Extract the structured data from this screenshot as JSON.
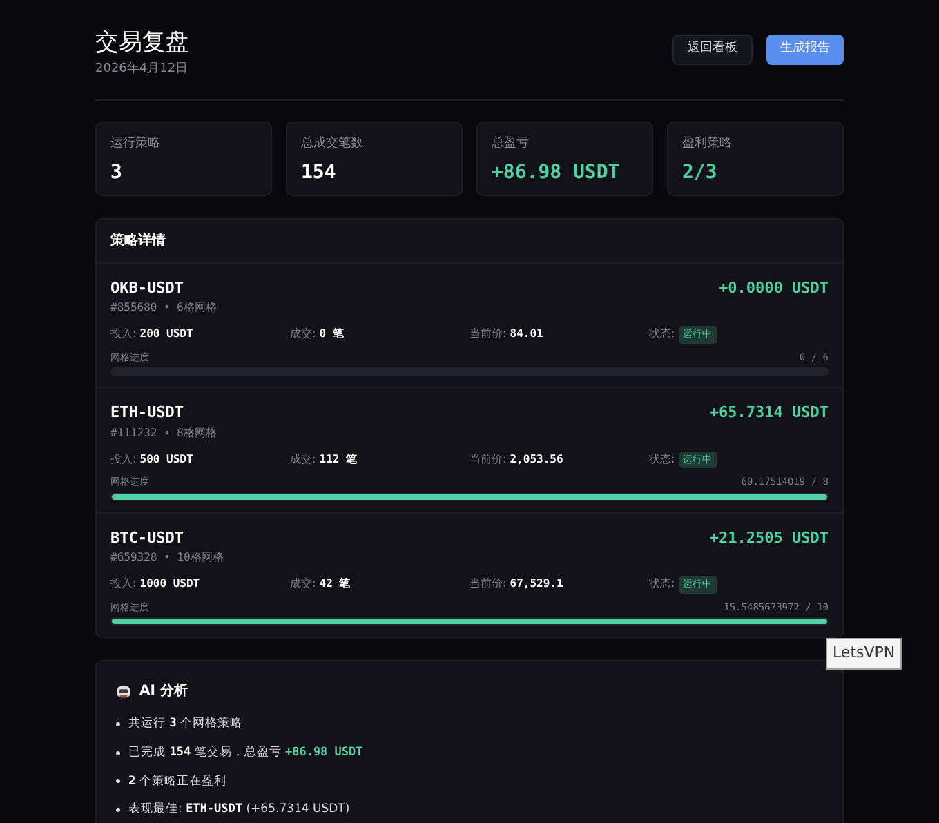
{
  "header": {
    "title": "交易复盘",
    "date": "2026年4月12日",
    "buttons": [
      {
        "label": "返回看板",
        "kind": "secondary"
      },
      {
        "label": "生成报告",
        "kind": "primary"
      }
    ]
  },
  "stats": [
    {
      "label": "运行策略",
      "value": "3",
      "kind": "plain"
    },
    {
      "label": "总成交笔数",
      "value": "154",
      "kind": "plain"
    },
    {
      "label": "总盈亏",
      "value": "+86.98 USDT",
      "kind": "profit"
    },
    {
      "label": "盈利策略",
      "value": "2/3",
      "kind": "profit"
    }
  ],
  "strategies": {
    "title": "策略详情",
    "items": [
      {
        "pair": "OKB-USDT",
        "meta": "#855680 • 6格网格",
        "pnl": "+0.0000 USDT",
        "invest_label": "投入:",
        "invest": "200 USDT",
        "trades_label": "成交:",
        "trades": "0 笔",
        "price_label": "当前价:",
        "price": "84.01",
        "status_label": "状态:",
        "status": "运行中",
        "progress_label": "网格进度",
        "progress_text": "0 / 6"
      },
      {
        "pair": "ETH-USDT",
        "meta": "#111232 • 8格网格",
        "pnl": "+65.7314 USDT",
        "invest_label": "投入:",
        "invest": "500 USDT",
        "trades_label": "成交:",
        "trades": "112 笔",
        "price_label": "当前价:",
        "price": "2,053.56",
        "status_label": "状态:",
        "status": "运行中",
        "progress_label": "网格进度",
        "progress_text": "60.17514019 / 8",
        "level": 1
      },
      {
        "pair": "BTC-USDT",
        "meta": "#659328 • 10格网格",
        "pnl": "+21.2505 USDT",
        "invest_label": "投入:",
        "invest": "1000 USDT",
        "trades_label": "成交:",
        "trades": "42 笔",
        "price_label": "当前价:",
        "price": "67,529.1",
        "status_label": "状态:",
        "status": "运行中",
        "progress_label": "网格进度",
        "progress_text": "15.5485673972 / 10",
        "level": 1
      }
    ]
  },
  "analysis": {
    "title": "AI 分析",
    "bullets": [
      [
        {
          "text": "共运行 ",
          "kind": "plain"
        },
        {
          "text": "3",
          "kind": "strong"
        },
        {
          "text": " 个网格策略",
          "kind": "plain"
        }
      ],
      [
        {
          "text": "已完成 ",
          "kind": "plain"
        },
        {
          "text": "154",
          "kind": "strong"
        },
        {
          "text": " 笔交易，总盈亏 ",
          "kind": "plain"
        },
        {
          "text": "+86.98 USDT",
          "kind": "profit"
        }
      ],
      [
        {
          "text": "2",
          "kind": "strong"
        },
        {
          "text": " 个策略正在盈利",
          "kind": "plain"
        }
      ],
      [
        {
          "text": "表现最佳: ",
          "kind": "plain"
        },
        {
          "text": "ETH-USDT",
          "kind": "strong"
        },
        {
          "text": " (+65.7314 USDT)",
          "kind": "plain"
        }
      ]
    ]
  },
  "tooltip": "LetsVPN"
}
